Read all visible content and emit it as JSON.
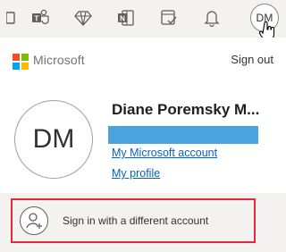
{
  "topbar": {
    "icons": [
      "teams-icon-partial",
      "teams-icon",
      "diamond-icon",
      "onenote-icon",
      "todo-icon",
      "bell-icon"
    ],
    "avatar_initials": "DM"
  },
  "account": {
    "brand": "Microsoft",
    "sign_out_label": "Sign out",
    "avatar_initials": "DM",
    "display_name": "Diane Poremsky M...",
    "email_redacted": true,
    "links": [
      "My Microsoft account",
      "My profile"
    ]
  },
  "switch_account": {
    "label": "Sign in with a different account"
  },
  "colors": {
    "logo_red": "#f25022",
    "logo_green": "#7fba00",
    "logo_blue": "#00a4ef",
    "logo_yellow": "#ffb900",
    "link_blue": "#0563c1",
    "highlight_border": "#e02b3c",
    "redaction": "#4aa3df"
  }
}
